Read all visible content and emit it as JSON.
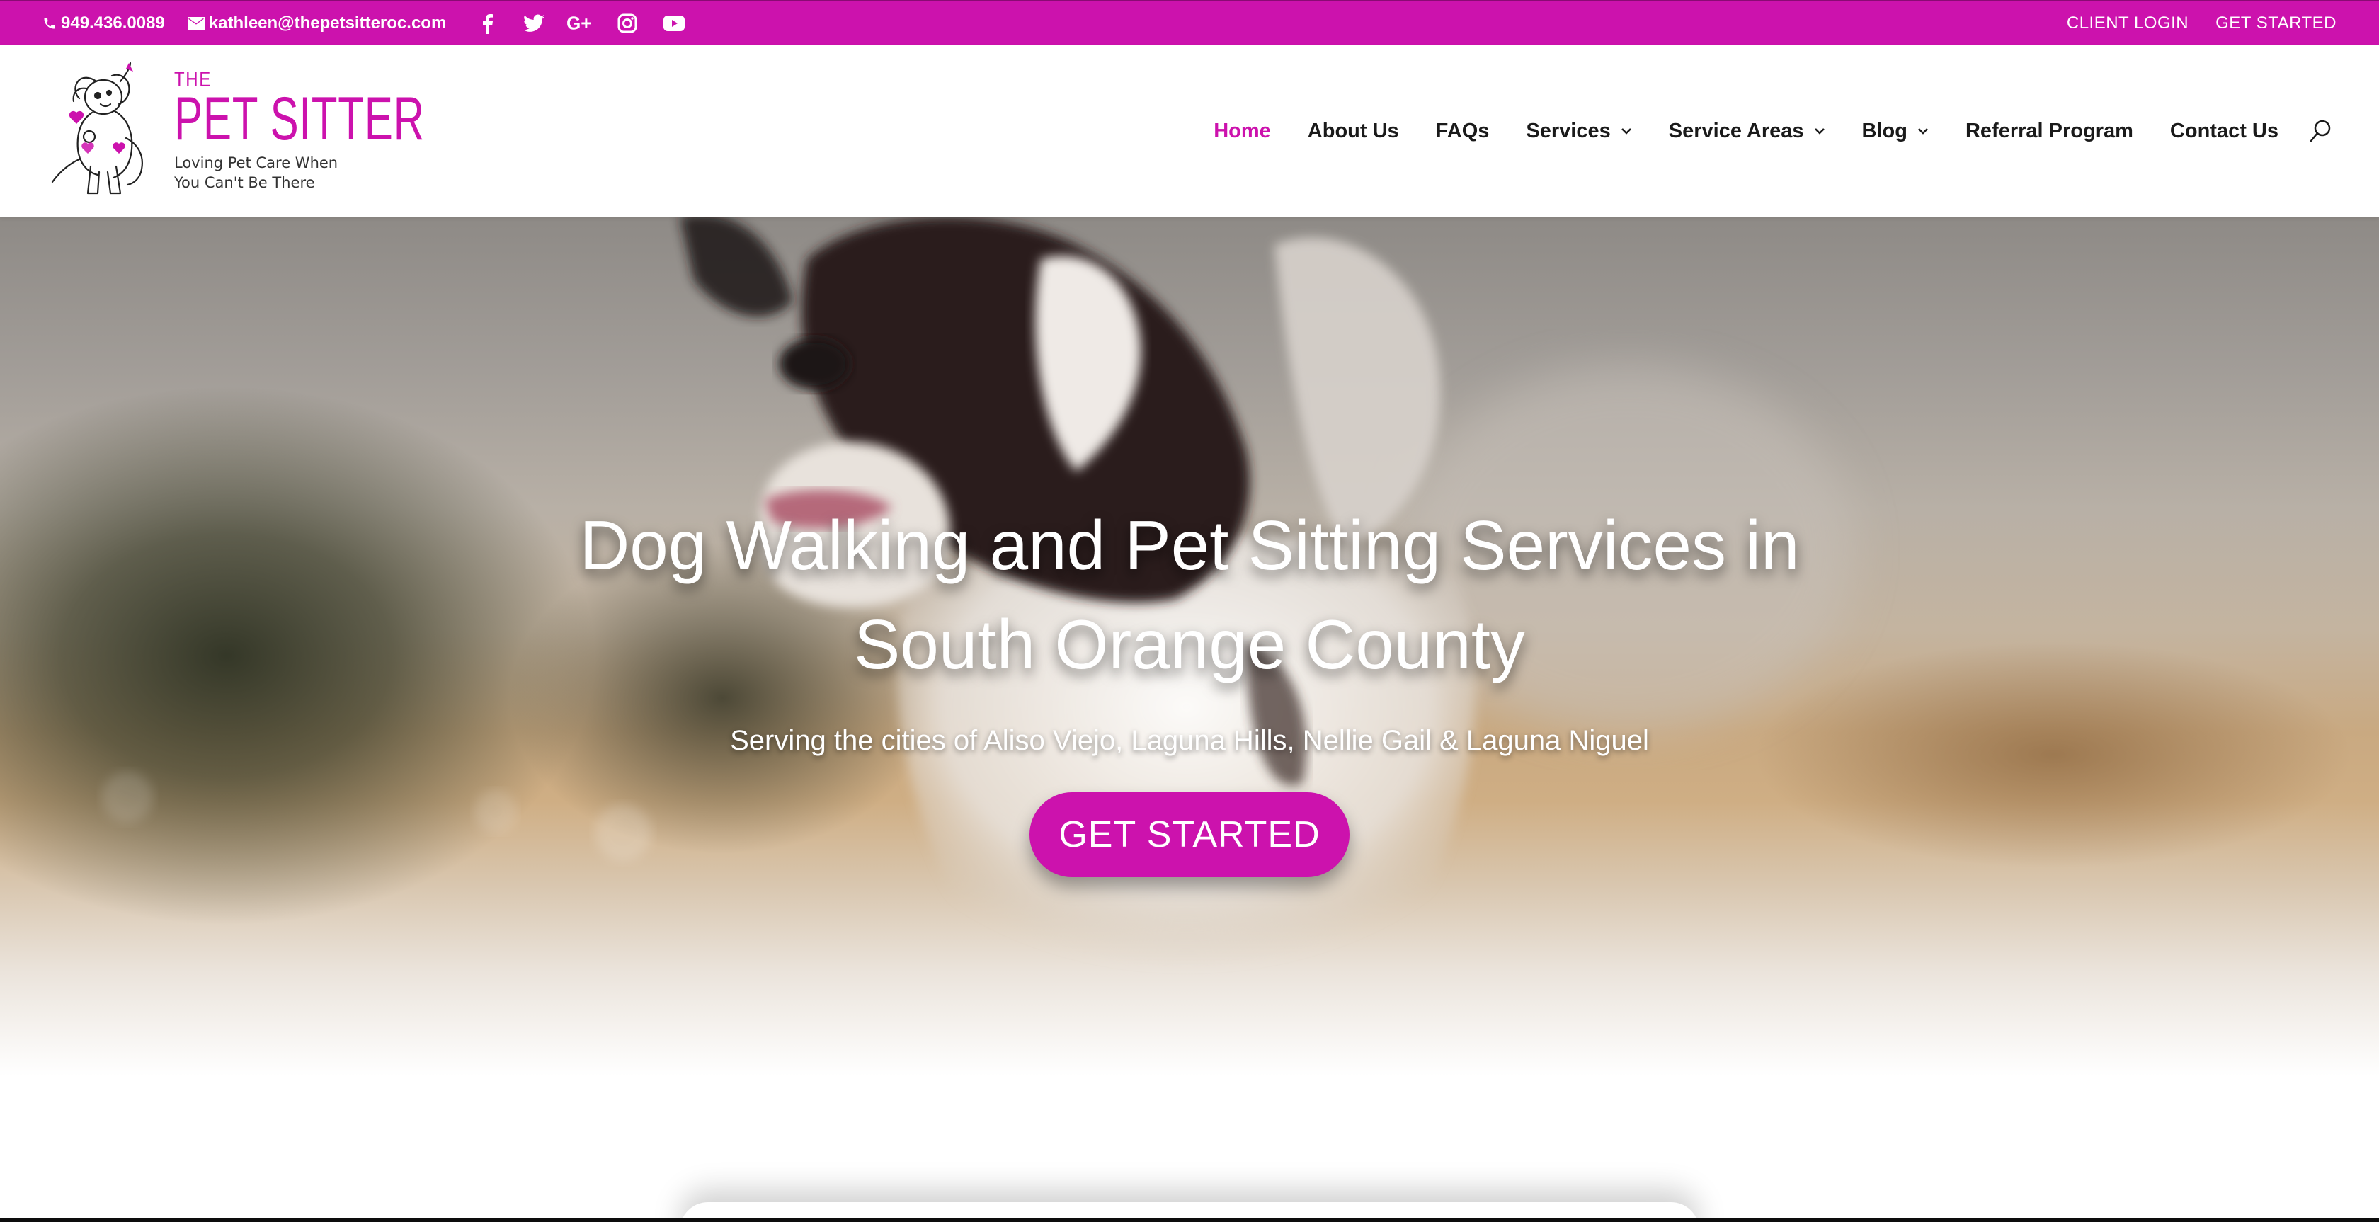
{
  "topbar": {
    "phone": "949.436.0089",
    "email": "kathleen@thepetsitteroc.com",
    "social": [
      "facebook-icon",
      "twitter-icon",
      "google-plus-icon",
      "instagram-icon",
      "youtube-icon"
    ],
    "links": {
      "client_login": "CLIENT LOGIN",
      "get_started": "GET STARTED"
    },
    "background": "#cc12ad"
  },
  "logo": {
    "the": "THE",
    "name": "PET SITTER",
    "tagline_line1": "Loving Pet Care When",
    "tagline_line2": "You Can't Be There"
  },
  "nav": {
    "items": [
      {
        "label": "Home",
        "active": true
      },
      {
        "label": "About Us"
      },
      {
        "label": "FAQs"
      },
      {
        "label": "Services",
        "dropdown": true
      },
      {
        "label": "Service Areas",
        "dropdown": true
      },
      {
        "label": "Blog",
        "dropdown": true
      },
      {
        "label": "Referral Program"
      },
      {
        "label": "Contact Us"
      }
    ],
    "search_icon": "search-icon"
  },
  "hero": {
    "title": "Dog Walking and Pet Sitting Services in South Orange County",
    "subtitle": "Serving the cities of Aliso Viejo, Laguna Hills, Nellie Gail & Laguna Niguel",
    "button": "GET STARTED"
  },
  "colors": {
    "accent": "#cc12ad",
    "text_dark": "#1a1a1a"
  }
}
